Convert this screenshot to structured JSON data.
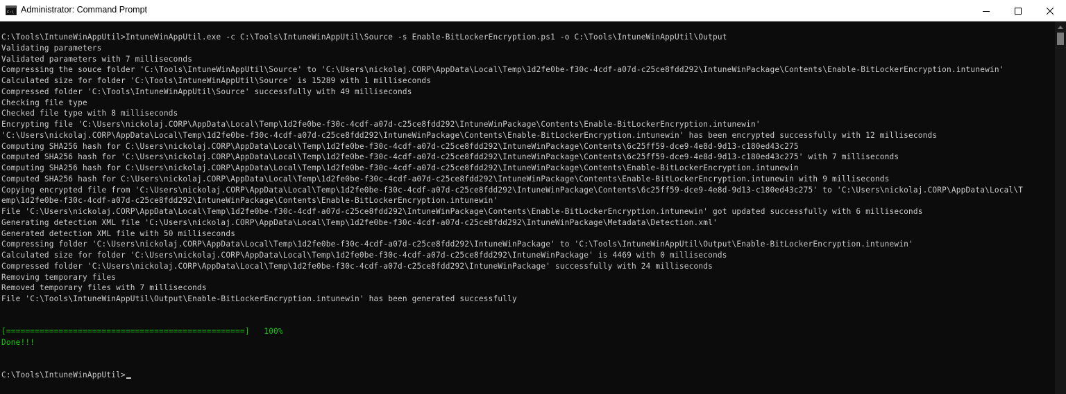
{
  "window": {
    "title": "Administrator: Command Prompt",
    "app_icon_text": "C:\\",
    "controls": {
      "minimize": "minimize",
      "maximize": "maximize",
      "close": "close"
    }
  },
  "console": {
    "lines": [
      "C:\\Tools\\IntuneWinAppUtil>IntuneWinAppUtil.exe -c C:\\Tools\\IntuneWinAppUtil\\Source -s Enable-BitLockerEncryption.ps1 -o C:\\Tools\\IntuneWinAppUtil\\Output",
      "Validating parameters",
      "Validated parameters with 7 milliseconds",
      "Compressing the souce folder 'C:\\Tools\\IntuneWinAppUtil\\Source' to 'C:\\Users\\nickolaj.CORP\\AppData\\Local\\Temp\\1d2fe0be-f30c-4cdf-a07d-c25ce8fdd292\\IntuneWinPackage\\Contents\\Enable-BitLockerEncryption.intunewin'",
      "Calculated size for folder 'C:\\Tools\\IntuneWinAppUtil\\Source' is 15289 with 1 milliseconds",
      "Compressed folder 'C:\\Tools\\IntuneWinAppUtil\\Source' successfully with 49 milliseconds",
      "Checking file type",
      "Checked file type with 8 milliseconds",
      "Encrypting file 'C:\\Users\\nickolaj.CORP\\AppData\\Local\\Temp\\1d2fe0be-f30c-4cdf-a07d-c25ce8fdd292\\IntuneWinPackage\\Contents\\Enable-BitLockerEncryption.intunewin'",
      "'C:\\Users\\nickolaj.CORP\\AppData\\Local\\Temp\\1d2fe0be-f30c-4cdf-a07d-c25ce8fdd292\\IntuneWinPackage\\Contents\\Enable-BitLockerEncryption.intunewin' has been encrypted successfully with 12 milliseconds",
      "Computing SHA256 hash for C:\\Users\\nickolaj.CORP\\AppData\\Local\\Temp\\1d2fe0be-f30c-4cdf-a07d-c25ce8fdd292\\IntuneWinPackage\\Contents\\6c25ff59-dce9-4e8d-9d13-c180ed43c275",
      "Computed SHA256 hash for 'C:\\Users\\nickolaj.CORP\\AppData\\Local\\Temp\\1d2fe0be-f30c-4cdf-a07d-c25ce8fdd292\\IntuneWinPackage\\Contents\\6c25ff59-dce9-4e8d-9d13-c180ed43c275' with 7 milliseconds",
      "Computing SHA256 hash for C:\\Users\\nickolaj.CORP\\AppData\\Local\\Temp\\1d2fe0be-f30c-4cdf-a07d-c25ce8fdd292\\IntuneWinPackage\\Contents\\Enable-BitLockerEncryption.intunewin",
      "Computed SHA256 hash for C:\\Users\\nickolaj.CORP\\AppData\\Local\\Temp\\1d2fe0be-f30c-4cdf-a07d-c25ce8fdd292\\IntuneWinPackage\\Contents\\Enable-BitLockerEncryption.intunewin with 9 milliseconds",
      "Copying encrypted file from 'C:\\Users\\nickolaj.CORP\\AppData\\Local\\Temp\\1d2fe0be-f30c-4cdf-a07d-c25ce8fdd292\\IntuneWinPackage\\Contents\\6c25ff59-dce9-4e8d-9d13-c180ed43c275' to 'C:\\Users\\nickolaj.CORP\\AppData\\Local\\T",
      "emp\\1d2fe0be-f30c-4cdf-a07d-c25ce8fdd292\\IntuneWinPackage\\Contents\\Enable-BitLockerEncryption.intunewin'",
      "File 'C:\\Users\\nickolaj.CORP\\AppData\\Local\\Temp\\1d2fe0be-f30c-4cdf-a07d-c25ce8fdd292\\IntuneWinPackage\\Contents\\Enable-BitLockerEncryption.intunewin' got updated successfully with 6 milliseconds",
      "Generating detection XML file 'C:\\Users\\nickolaj.CORP\\AppData\\Local\\Temp\\1d2fe0be-f30c-4cdf-a07d-c25ce8fdd292\\IntuneWinPackage\\Metadata\\Detection.xml'",
      "Generated detection XML file with 50 milliseconds",
      "Compressing folder 'C:\\Users\\nickolaj.CORP\\AppData\\Local\\Temp\\1d2fe0be-f30c-4cdf-a07d-c25ce8fdd292\\IntuneWinPackage' to 'C:\\Tools\\IntuneWinAppUtil\\Output\\Enable-BitLockerEncryption.intunewin'",
      "Calculated size for folder 'C:\\Users\\nickolaj.CORP\\AppData\\Local\\Temp\\1d2fe0be-f30c-4cdf-a07d-c25ce8fdd292\\IntuneWinPackage' is 4469 with 0 milliseconds",
      "Compressed folder 'C:\\Users\\nickolaj.CORP\\AppData\\Local\\Temp\\1d2fe0be-f30c-4cdf-a07d-c25ce8fdd292\\IntuneWinPackage' successfully with 24 milliseconds",
      "Removing temporary files",
      "Removed temporary files with 7 milliseconds",
      "File 'C:\\Tools\\IntuneWinAppUtil\\Output\\Enable-BitLockerEncryption.intunewin' has been generated successfully"
    ],
    "progress_text": "[==================================================]   100%",
    "progress_percent": 100,
    "done_text": "Done!!!",
    "prompt": "C:\\Tools\\IntuneWinAppUtil>"
  },
  "colors": {
    "background": "#0c0c0c",
    "text": "#cccccc",
    "success": "#16c60c"
  }
}
